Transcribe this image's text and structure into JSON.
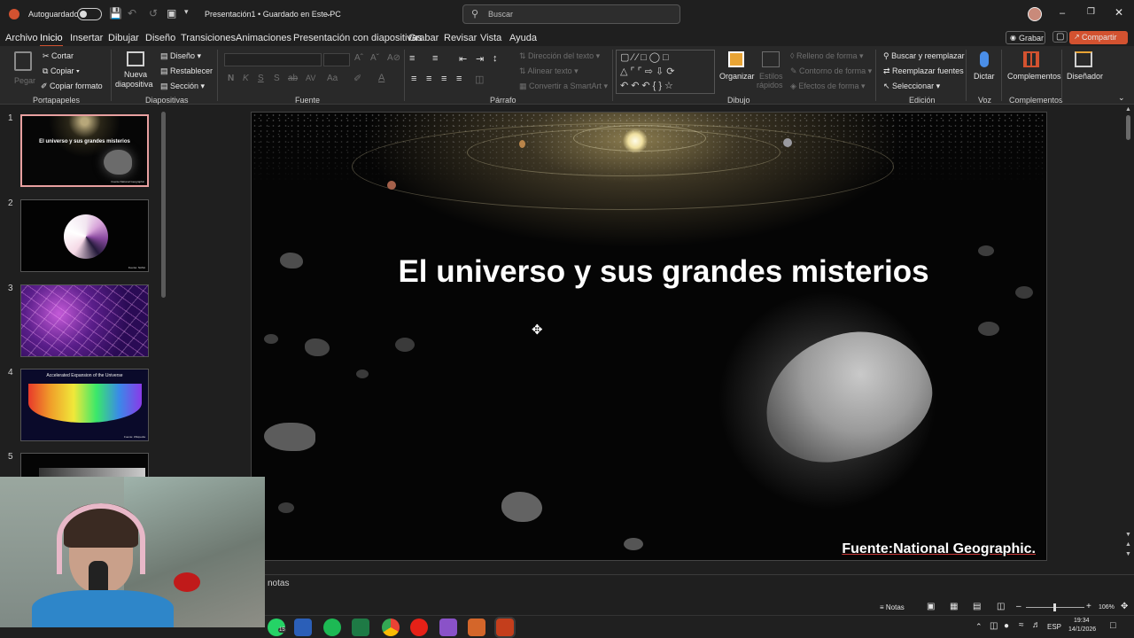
{
  "titlebar": {
    "autosave_label": "Autoguardado",
    "autosave_state": "off",
    "document_title": "Presentación1 • Guardado en Este PC",
    "search_placeholder": "Buscar"
  },
  "menu": {
    "tabs": [
      "Archivo",
      "Inicio",
      "Insertar",
      "Dibujar",
      "Diseño",
      "Transiciones",
      "Animaciones",
      "Presentación con diapositivas",
      "Grabar",
      "Revisar",
      "Vista",
      "Ayuda"
    ],
    "active_tab": "Inicio",
    "record_label": "Grabar",
    "share_label": "Compartir"
  },
  "ribbon": {
    "clipboard": {
      "paste": "Pegar",
      "cut": "Cortar",
      "copy": "Copiar",
      "format_painter": "Copiar formato",
      "group": "Portapapeles"
    },
    "slides": {
      "new_slide_1": "Nueva",
      "new_slide_2": "diapositiva",
      "layout": "Diseño",
      "reset": "Restablecer",
      "section": "Sección",
      "group": "Diapositivas"
    },
    "font": {
      "bold": "N",
      "italic": "K",
      "underline": "S",
      "strike": "S",
      "spacing": "AV",
      "case": "Aa",
      "group": "Fuente"
    },
    "paragraph": {
      "text_direction": "Dirección del texto",
      "align_text": "Alinear texto",
      "smartart": "Convertir a SmartArt",
      "group": "Párrafo"
    },
    "drawing": {
      "arrange": "Organizar",
      "quick_styles_1": "Estilos",
      "quick_styles_2": "rápidos",
      "shape_fill": "Relleno de forma",
      "shape_outline": "Contorno de forma",
      "shape_effects": "Efectos de forma",
      "group": "Dibujo"
    },
    "editing": {
      "find_replace": "Buscar y reemplazar",
      "replace_fonts": "Reemplazar fuentes",
      "select": "Seleccionar",
      "group": "Edición"
    },
    "voice": {
      "dictate": "Dictar",
      "group": "Voz"
    },
    "addins": {
      "addins": "Complementos",
      "group": "Complementos"
    },
    "designer": {
      "label": "Diseñador"
    }
  },
  "thumbnails": [
    {
      "num": "1",
      "title": "El universo y sus grandes misterios",
      "caption": "Fuente:National Geographic"
    },
    {
      "num": "2",
      "caption": "Fuente: NASA"
    },
    {
      "num": "3",
      "caption": ""
    },
    {
      "num": "4",
      "title": "Accelerated Expansion of the Universe",
      "caption": "Fuente: Wikipedia"
    },
    {
      "num": "5",
      "caption": ""
    }
  ],
  "slide": {
    "title": "El universo y sus grandes misterios",
    "source": "Fuente:National Geographic."
  },
  "notes": {
    "label": "notas"
  },
  "status": {
    "notes_button": "Notas",
    "zoom": "106%"
  },
  "tray": {
    "lang": "ESP",
    "time": "19:34",
    "date": "14/1/2026",
    "badge": "15"
  },
  "colors": {
    "accent": "#d35230",
    "ribbon_bg": "#292929",
    "app_bg": "#1f1f1f"
  }
}
